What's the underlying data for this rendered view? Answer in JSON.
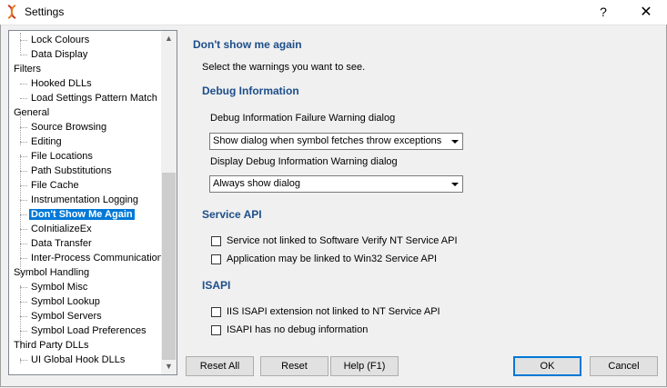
{
  "window": {
    "title": "Settings",
    "help_glyph": "?",
    "close_glyph": "✕"
  },
  "tree": {
    "items": [
      {
        "label": "Lock Colours",
        "level": 1
      },
      {
        "label": "Data Display",
        "level": 1
      },
      {
        "label": "Filters",
        "level": 0
      },
      {
        "label": "Hooked DLLs",
        "level": 1
      },
      {
        "label": "Load Settings Pattern Match",
        "level": 1
      },
      {
        "label": "General",
        "level": 0
      },
      {
        "label": "Source Browsing",
        "level": 1
      },
      {
        "label": "Editing",
        "level": 1
      },
      {
        "label": "File Locations",
        "level": 1
      },
      {
        "label": "Path Substitutions",
        "level": 1
      },
      {
        "label": "File Cache",
        "level": 1
      },
      {
        "label": "Instrumentation Logging",
        "level": 1
      },
      {
        "label": "Don't Show Me Again",
        "level": 1,
        "selected": true
      },
      {
        "label": "CoInitializeEx",
        "level": 1
      },
      {
        "label": "Data Transfer",
        "level": 1
      },
      {
        "label": "Inter-Process Communication",
        "level": 1
      },
      {
        "label": "Symbol Handling",
        "level": 0
      },
      {
        "label": "Symbol Misc",
        "level": 1
      },
      {
        "label": "Symbol Lookup",
        "level": 1
      },
      {
        "label": "Symbol Servers",
        "level": 1
      },
      {
        "label": "Symbol Load Preferences",
        "level": 1
      },
      {
        "label": "Third Party DLLs",
        "level": 0
      },
      {
        "label": "UI Global Hook DLLs",
        "level": 1
      }
    ]
  },
  "panel": {
    "title": "Don't show me again",
    "instructions": "Select the warnings you want to see.",
    "debug": {
      "heading": "Debug Information",
      "failure_label": "Debug Information Failure Warning dialog",
      "failure_value": "Show dialog when symbol fetches throw exceptions",
      "display_label": "Display Debug Information Warning dialog",
      "display_value": "Always show dialog"
    },
    "service": {
      "heading": "Service API",
      "check1": "Service not linked to Software Verify NT Service API",
      "check2": "Application may be linked to Win32 Service API"
    },
    "isapi": {
      "heading": "ISAPI",
      "check1": "IIS ISAPI extension not linked to NT Service API",
      "check2": "ISAPI has no debug information"
    }
  },
  "buttons": {
    "reset_all": "Reset All",
    "reset": "Reset",
    "help": "Help (F1)",
    "ok": "OK",
    "cancel": "Cancel"
  }
}
